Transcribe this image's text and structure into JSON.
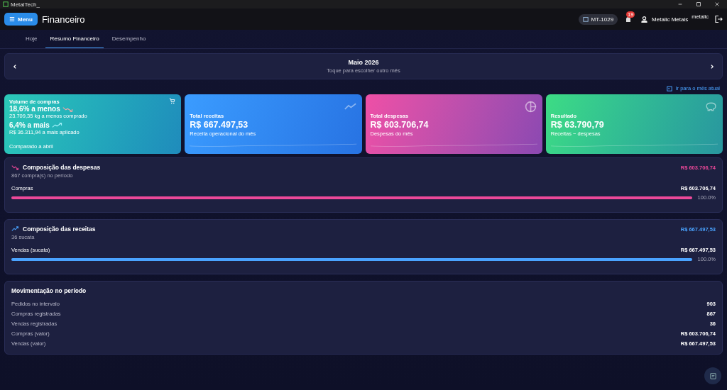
{
  "window": {
    "title": "MetalTech_"
  },
  "header": {
    "menu_label": "Menu",
    "title": "Financeiro",
    "unit_badge": "MT-1029",
    "notifications": "19",
    "user": "Metalic Metais",
    "user_tag": "metalic"
  },
  "tabs": [
    {
      "label": "Hoje",
      "selected": false
    },
    {
      "label": "Resumo Financeiro",
      "selected": true
    },
    {
      "label": "Desempenho",
      "selected": false
    }
  ],
  "month": {
    "title": "Maio 2026",
    "hint": "Toque para escolher outro mês"
  },
  "current_month_link": "Ir para o mês atual",
  "cards": [
    {
      "kind": "compare",
      "color": "#2cc9b8",
      "title": "Volume de compras",
      "lines": [
        {
          "kind": "decrease",
          "headline": "18,6% a menos",
          "detail": "23.709,35 kg a menos comprado"
        },
        {
          "kind": "increase",
          "headline": "6,4% a mais",
          "detail": "R$ 36.311,94 a mais aplicado"
        }
      ],
      "footer": "Comparado a abril"
    },
    {
      "kind": "total",
      "color": "#3b9cff",
      "title": "Total receitas",
      "value": "R$ 667.497,53",
      "caption": "Receita operacional do mês"
    },
    {
      "kind": "total",
      "color": "#ef4fa6",
      "title": "Total despesas",
      "value": "R$ 603.706,74",
      "caption": "Despesas do mês"
    },
    {
      "kind": "total",
      "color": "#3ddc84",
      "title": "Resultado",
      "value": "R$ 63.790,79",
      "caption": "Receitas − despesas"
    }
  ],
  "compositions": [
    {
      "kind": "expenses",
      "color": "#ec4899",
      "title": "Composição das despesas",
      "subtitle": "867 compra(s) no período",
      "total": "R$ 603.706,74",
      "items": [
        {
          "label": "Compras",
          "value": "R$ 603.706,74",
          "level": 1,
          "percent": "100.0%"
        }
      ]
    },
    {
      "kind": "revenues",
      "color": "#4aa3ff",
      "title": "Composição das receitas",
      "subtitle": "36 sucata",
      "total": "R$ 667.497,53",
      "items": [
        {
          "label": "Vendas (sucata)",
          "value": "R$ 667.497,53",
          "level": 1,
          "percent": "100.0%"
        }
      ]
    }
  ],
  "movement": {
    "title": "Movimentação no período",
    "rows": [
      {
        "label": "Pedidos no intervalo",
        "value": "903"
      },
      {
        "label": "Compras registradas",
        "value": "867"
      },
      {
        "label": "Vendas registradas",
        "value": "36"
      },
      {
        "label": "Compras (valor)",
        "value": "R$ 603.706,74"
      },
      {
        "label": "Vendas (valor)",
        "value": "R$ 667.497,53"
      }
    ]
  }
}
